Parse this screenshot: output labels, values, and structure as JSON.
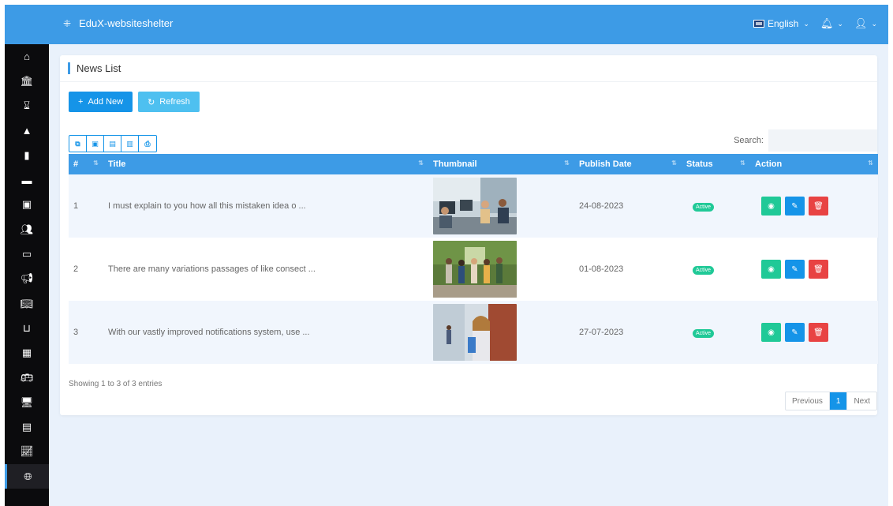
{
  "app": {
    "brand": "EduX-websiteshelter"
  },
  "topbar": {
    "language": "English"
  },
  "sidebar": {
    "items": [
      {
        "icon": "home-icon"
      },
      {
        "icon": "bank-icon"
      },
      {
        "icon": "hourglass-icon"
      },
      {
        "icon": "graduation-icon"
      },
      {
        "icon": "file-icon"
      },
      {
        "icon": "book-icon"
      },
      {
        "icon": "money-icon"
      },
      {
        "icon": "users-icon"
      },
      {
        "icon": "card-icon"
      },
      {
        "icon": "megaphone-icon"
      },
      {
        "icon": "library-icon"
      },
      {
        "icon": "dolly-icon"
      },
      {
        "icon": "building-icon"
      },
      {
        "icon": "bus-icon"
      },
      {
        "icon": "monitor-icon"
      },
      {
        "icon": "id-card-icon"
      },
      {
        "icon": "chart-line-icon"
      },
      {
        "icon": "globe-icon"
      }
    ]
  },
  "page": {
    "title": "News List",
    "add_label": "Add New",
    "refresh_label": "Refresh",
    "search_label": "Search:",
    "columns": [
      "#",
      "Title",
      "Thumbnail",
      "Publish Date",
      "Status",
      "Action"
    ],
    "rows": [
      {
        "num": "1",
        "title": "I must explain to you how all this mistaken idea o ...",
        "date": "24-08-2023",
        "status": "Active"
      },
      {
        "num": "2",
        "title": "There are many variations passages of like consect ...",
        "date": "01-08-2023",
        "status": "Active"
      },
      {
        "num": "3",
        "title": "With our vastly improved notifications system, use ...",
        "date": "27-07-2023",
        "status": "Active"
      }
    ],
    "info": "Showing 1 to 3 of 3 entries",
    "pagination": {
      "previous": "Previous",
      "current": "1",
      "next": "Next"
    }
  }
}
